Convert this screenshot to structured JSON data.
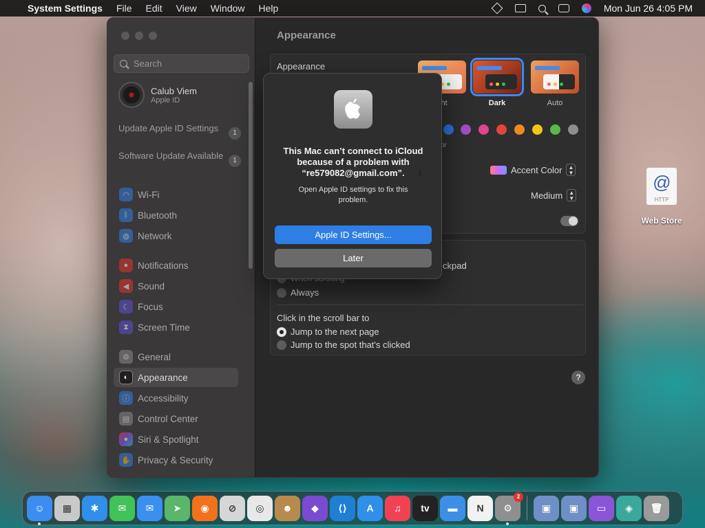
{
  "menubar": {
    "app_name": "System Settings",
    "menus": [
      "File",
      "Edit",
      "View",
      "Window",
      "Help"
    ],
    "clock": "Mon Jun 26  4:05 PM"
  },
  "sidebar": {
    "search_placeholder": "Search",
    "account": {
      "name": "Calub Viem",
      "subtitle": "Apple ID"
    },
    "notices": [
      {
        "label": "Update Apple ID Settings",
        "count": "1"
      },
      {
        "label": "Software Update Available",
        "count": "1"
      }
    ],
    "items": [
      {
        "label": "Wi-Fi",
        "icon": "wifi-icon",
        "color": "#2f7ee6"
      },
      {
        "label": "Bluetooth",
        "icon": "bluetooth-icon",
        "color": "#2f7ee6"
      },
      {
        "label": "Network",
        "icon": "globe-icon",
        "color": "#2f7ee6"
      },
      {
        "label": "Notifications",
        "icon": "bell-icon",
        "color": "#e5322e"
      },
      {
        "label": "Sound",
        "icon": "speaker-icon",
        "color": "#e5322e"
      },
      {
        "label": "Focus",
        "icon": "moon-icon",
        "color": "#5b4fd6"
      },
      {
        "label": "Screen Time",
        "icon": "hourglass-icon",
        "color": "#5b4fd6"
      },
      {
        "label": "General",
        "icon": "gear-icon",
        "color": "#8a8a8a"
      },
      {
        "label": "Appearance",
        "icon": "appearance-icon",
        "color": "#1b1b1b"
      },
      {
        "label": "Accessibility",
        "icon": "accessibility-icon",
        "color": "#2f7ee6"
      },
      {
        "label": "Control Center",
        "icon": "control-center-icon",
        "color": "#8a8a8a"
      },
      {
        "label": "Siri & Spotlight",
        "icon": "siri-icon",
        "color": "#9b4fd6"
      },
      {
        "label": "Privacy & Security",
        "icon": "hand-icon",
        "color": "#2f7ee6"
      }
    ]
  },
  "main": {
    "title": "Appearance",
    "appearance_label": "Appearance",
    "modes": [
      {
        "label": "ght",
        "selected": false
      },
      {
        "label": "Dark",
        "selected": true
      },
      {
        "label": "Auto",
        "selected": false
      }
    ],
    "accent_colors": [
      "#2f6fd8",
      "#a04fc4",
      "#e0448a",
      "#e5443a",
      "#f08a1c",
      "#f4c419",
      "#59b94a",
      "#8e8e8e"
    ],
    "accent_label_fragment": "or",
    "highlight_color": {
      "label": "Accent Color"
    },
    "sidebar_icon_size": {
      "value": "Medium"
    },
    "scroll_fragment": "ckpad",
    "when_scrolling_fragment": "When scrolling",
    "always_label": "Always",
    "click_scroll_title": "Click in the scroll bar to",
    "click_options": [
      {
        "label": "Jump to the next page",
        "selected": true
      },
      {
        "label": "Jump to the spot that's clicked",
        "selected": false
      }
    ],
    "help": "?"
  },
  "alert": {
    "title": "This Mac can’t connect to iCloud because of a problem with “re579082@gmail.com”.",
    "message": "Open Apple ID settings to fix this problem.",
    "primary_button": "Apple ID Settings...",
    "secondary_button": "Later"
  },
  "desktop": {
    "icon_label": "Web Store",
    "icon_symbol": "@",
    "icon_caption": "HTTP"
  },
  "dock": {
    "apps": [
      {
        "name": "finder-icon",
        "color": "#3b8df0",
        "glyph": "☺",
        "running": true
      },
      {
        "name": "launchpad-icon",
        "color": "#c9c9c9",
        "glyph": "▦",
        "running": false
      },
      {
        "name": "safari-icon",
        "color": "#2f8fe9",
        "glyph": "✱",
        "running": false
      },
      {
        "name": "messages-icon",
        "color": "#43c25a",
        "glyph": "✉",
        "running": false
      },
      {
        "name": "mail-icon",
        "color": "#3a90ef",
        "glyph": "✉",
        "running": false
      },
      {
        "name": "maps-icon",
        "color": "#59b66a",
        "glyph": "➤",
        "running": false
      },
      {
        "name": "firefox-icon",
        "color": "#f2711c",
        "glyph": "◉",
        "running": false
      },
      {
        "name": "no-entry-icon",
        "color": "#d6d6d6",
        "glyph": "⊘",
        "running": false
      },
      {
        "name": "chrome-icon",
        "color": "#e8e8e8",
        "glyph": "◎",
        "running": false
      },
      {
        "name": "contacts-icon",
        "color": "#b98a4e",
        "glyph": "☻",
        "running": false
      },
      {
        "name": "visual-studio-icon",
        "color": "#7a4bd0",
        "glyph": "◆",
        "running": false
      },
      {
        "name": "vscode-icon",
        "color": "#1f7fd4",
        "glyph": "⟨⟩",
        "running": false
      },
      {
        "name": "app-store-icon",
        "color": "#2f8fe9",
        "glyph": "A",
        "running": false
      },
      {
        "name": "music-icon",
        "color": "#f24152",
        "glyph": "♫",
        "running": false
      },
      {
        "name": "apple-tv-icon",
        "color": "#222222",
        "glyph": "tv",
        "running": false
      },
      {
        "name": "keynote-icon",
        "color": "#3d8fe6",
        "glyph": "▬",
        "running": false
      },
      {
        "name": "news-icon",
        "color": "#f2f2f2",
        "glyph": "N",
        "running": false
      },
      {
        "name": "system-settings-icon",
        "color": "#8f8f8f",
        "glyph": "⚙",
        "running": true,
        "badge": "2"
      }
    ],
    "utilities": [
      {
        "name": "virtualbox-icon",
        "color": "#6f8fc7",
        "glyph": "▣"
      },
      {
        "name": "virtualbox-2-icon",
        "color": "#6f8fc7",
        "glyph": "▣"
      },
      {
        "name": "podcast-icon",
        "color": "#8b55d8",
        "glyph": "▭"
      },
      {
        "name": "downloads-icon",
        "color": "#3aa99c",
        "glyph": "◈"
      },
      {
        "name": "trash-icon",
        "color": "#9a9a9a",
        "glyph": "🗑"
      }
    ]
  }
}
